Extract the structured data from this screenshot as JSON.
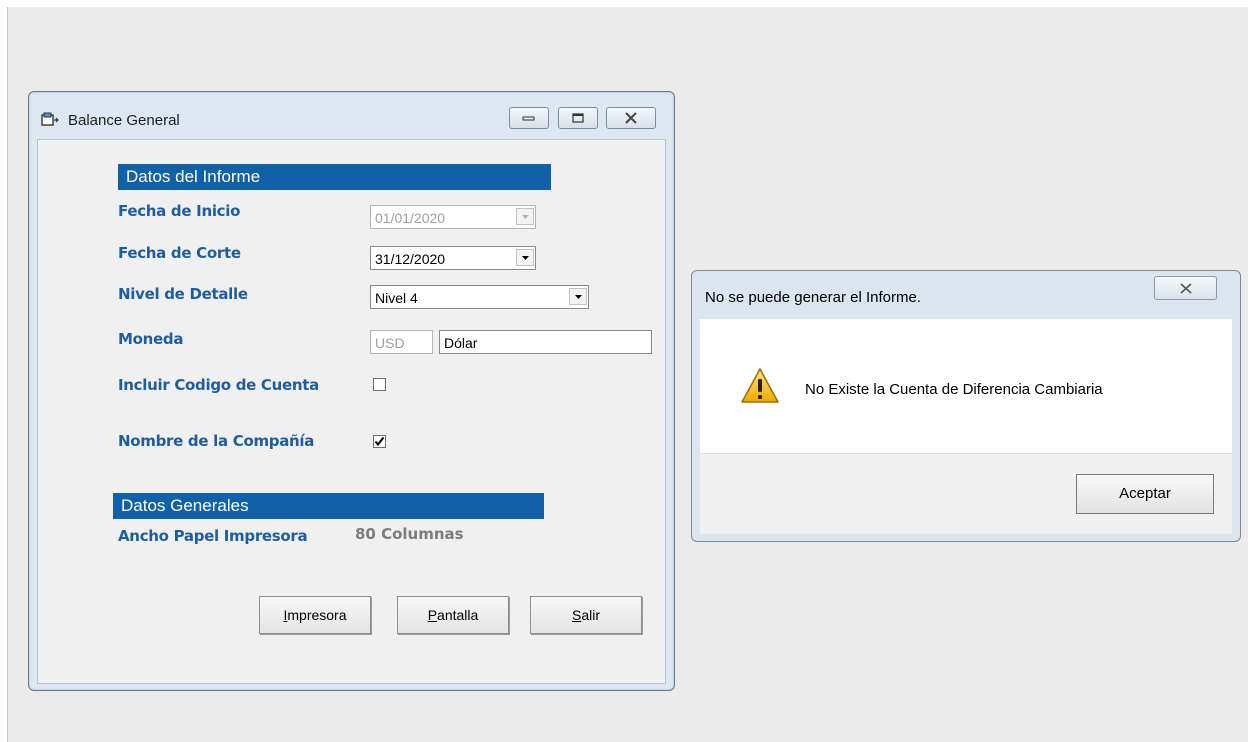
{
  "main_window": {
    "title": "Balance General",
    "section_report": "Datos del Informe",
    "fecha_inicio": {
      "label": "Fecha de Inicio",
      "value": "01/01/2020"
    },
    "fecha_corte": {
      "label": "Fecha de Corte",
      "value": "31/12/2020"
    },
    "nivel_detalle": {
      "label": "Nivel de Detalle",
      "value": "Nivel 4"
    },
    "moneda": {
      "label": "Moneda",
      "code": "USD",
      "name": "Dólar"
    },
    "incluir_codigo": {
      "label": "Incluir Codigo de Cuenta",
      "checked": false
    },
    "nombre_compania": {
      "label": "Nombre de la Compañía",
      "checked": true
    },
    "section_general": "Datos Generales",
    "ancho_papel": {
      "label": "Ancho Papel Impresora",
      "value": "80 Columnas"
    },
    "buttons": {
      "impresora": {
        "first": "I",
        "rest": "mpresora"
      },
      "pantalla": {
        "first": "P",
        "rest": "antalla"
      },
      "salir": {
        "first": "S",
        "rest": "alir"
      }
    }
  },
  "dialog": {
    "title": "No se puede generar el Informe.",
    "message": "No Existe la Cuenta de Diferencia Cambiaria",
    "ok_label": "Aceptar",
    "icon": "warning-icon"
  },
  "colors": {
    "section_blue": "#1061a8",
    "label_blue": "#1e5ea0"
  }
}
